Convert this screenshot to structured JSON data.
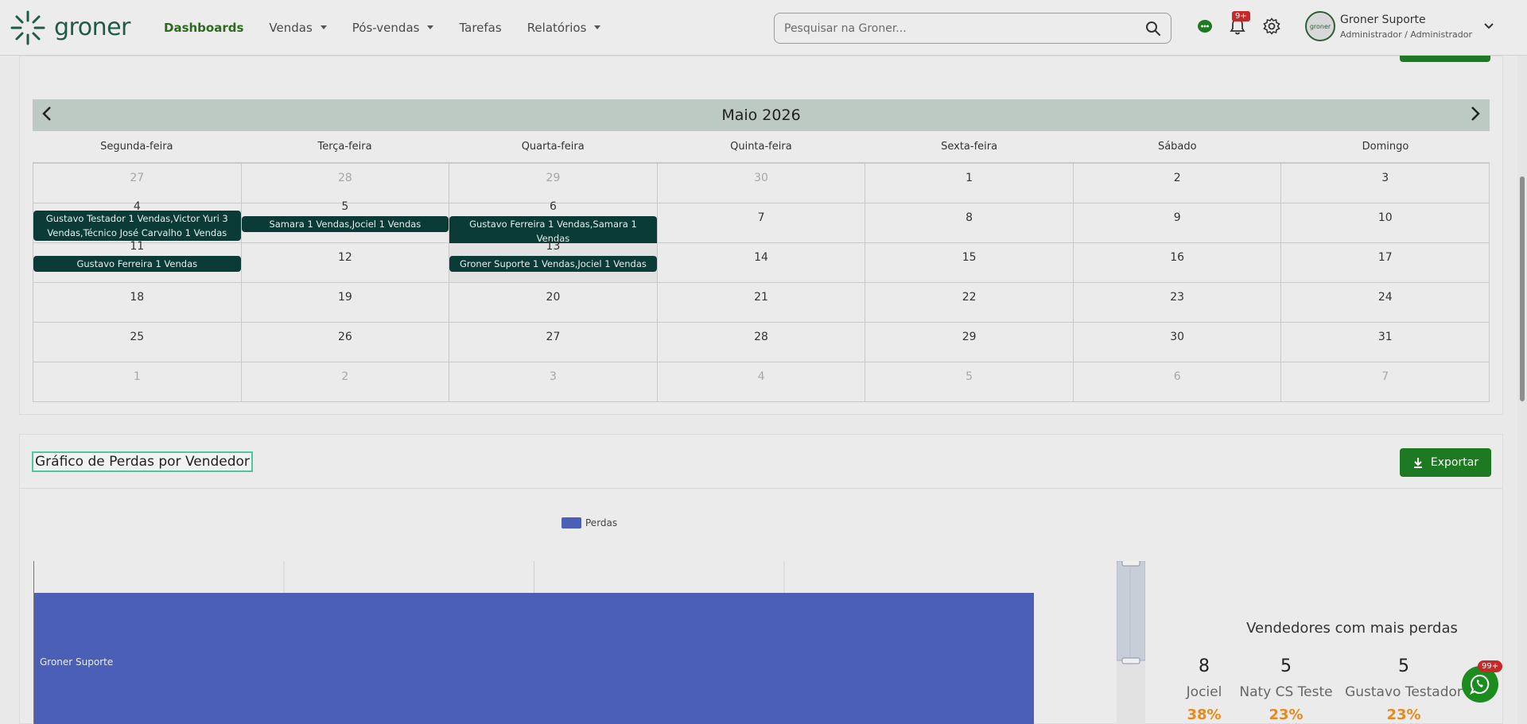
{
  "header": {
    "logo_text": "groner",
    "nav": [
      {
        "label": "Dashboards",
        "active": true,
        "dropdown": false
      },
      {
        "label": "Vendas",
        "active": false,
        "dropdown": true
      },
      {
        "label": "Pós-vendas",
        "active": false,
        "dropdown": true
      },
      {
        "label": "Tarefas",
        "active": false,
        "dropdown": false
      },
      {
        "label": "Relatórios",
        "active": false,
        "dropdown": true
      }
    ],
    "search_placeholder": "Pesquisar na Groner...",
    "notifications_badge": "9+",
    "user_name": "Groner Suporte",
    "user_role": "Administrador / Administrador",
    "avatar_text": "groner"
  },
  "calendar": {
    "month_title": "Maio 2026",
    "weekdays": [
      "Segunda-feira",
      "Terça-feira",
      "Quarta-feira",
      "Quinta-feira",
      "Sexta-feira",
      "Sábado",
      "Domingo"
    ],
    "weeks": [
      [
        {
          "d": "27",
          "m": true
        },
        {
          "d": "28",
          "m": true
        },
        {
          "d": "29",
          "m": true
        },
        {
          "d": "30",
          "m": true
        },
        {
          "d": "1"
        },
        {
          "d": "2"
        },
        {
          "d": "3"
        }
      ],
      [
        {
          "d": "4",
          "ev": "Gustavo Testador 1 Vendas,Victor Yuri 3 Vendas,Técnico José Carvalho 1 Vendas"
        },
        {
          "d": "5",
          "ev": "Samara 1 Vendas,Jociel 1 Vendas"
        },
        {
          "d": "6",
          "ev": "Gustavo Ferreira 1 Vendas,Samara 1 Vendas"
        },
        {
          "d": "7"
        },
        {
          "d": "8"
        },
        {
          "d": "9"
        },
        {
          "d": "10"
        }
      ],
      [
        {
          "d": "11",
          "ev": "Gustavo Ferreira 1 Vendas"
        },
        {
          "d": "12"
        },
        {
          "d": "13",
          "ev": "Groner Suporte 1 Vendas,Jociel 1 Vendas",
          "today": true
        },
        {
          "d": "14"
        },
        {
          "d": "15"
        },
        {
          "d": "16"
        },
        {
          "d": "17"
        }
      ],
      [
        {
          "d": "18"
        },
        {
          "d": "19"
        },
        {
          "d": "20"
        },
        {
          "d": "21"
        },
        {
          "d": "22"
        },
        {
          "d": "23"
        },
        {
          "d": "24"
        }
      ],
      [
        {
          "d": "25"
        },
        {
          "d": "26"
        },
        {
          "d": "27"
        },
        {
          "d": "28"
        },
        {
          "d": "29"
        },
        {
          "d": "30"
        },
        {
          "d": "31"
        }
      ],
      [
        {
          "d": "1",
          "m": true
        },
        {
          "d": "2",
          "m": true
        },
        {
          "d": "3",
          "m": true
        },
        {
          "d": "4",
          "m": true
        },
        {
          "d": "5",
          "m": true
        },
        {
          "d": "6",
          "m": true
        },
        {
          "d": "7",
          "m": true
        }
      ]
    ]
  },
  "losses_chart": {
    "title": "Gráfico de Perdas por Vendedor",
    "export_label": "Exportar",
    "ranking_title": "Vendedores com mais perdas",
    "ranking": [
      {
        "count": "8",
        "name": "Jociel",
        "pct": "38%"
      },
      {
        "count": "5",
        "name": "Naty CS Teste",
        "pct": "23%"
      },
      {
        "count": "5",
        "name": "Gustavo Testador",
        "pct": "23%"
      }
    ]
  },
  "chart_data": {
    "type": "bar",
    "orientation": "horizontal",
    "categories": [
      "Groner Suporte"
    ],
    "series": [
      {
        "name": "Perdas",
        "color": "#4a5fb5",
        "values": [
          null
        ]
      }
    ],
    "legend": "top",
    "grid": true
  },
  "whatsapp_badge": "99+",
  "colors": {
    "brand_green": "#1d7a22",
    "event_bg": "#0a3b36",
    "bar": "#4a5fb5",
    "accent_orange": "#e8891c"
  }
}
